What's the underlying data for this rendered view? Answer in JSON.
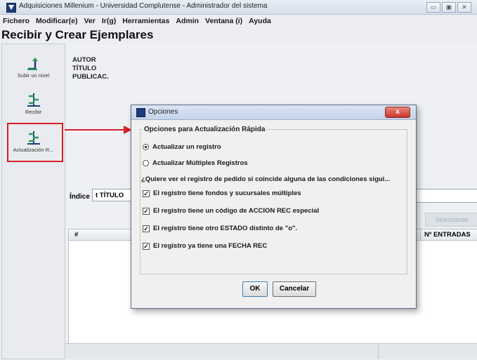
{
  "window": {
    "title": "Adquisiciones Millenium - Universidad Complutense - Administrador del sistema",
    "controls": [
      "▭",
      "▣",
      "✕"
    ]
  },
  "menu": [
    "Fichero",
    "Modificar(e)",
    "Ver",
    "Ir(g)",
    "Herramientas",
    "Admin",
    "Ventana (i)",
    "Ayuda"
  ],
  "page_title": "Recibir y Crear Ejemplares",
  "toolbar": {
    "subir_label": "Subir un nivel",
    "recibir_label": "Recibir",
    "actualizacion_label": "Actualización R..."
  },
  "record_meta": {
    "autor": "AUTOR",
    "titulo": "TÍTULO",
    "publicac": "PUBLICAC."
  },
  "search": {
    "indice_label": "Índice",
    "indice_value": "t TÍTULO",
    "seleccionar_label": "Seleccionar"
  },
  "table": {
    "col_hash": "#",
    "col_entradas": "Nº ENTRADAS"
  },
  "dialog": {
    "title": "Opciones",
    "close": "x",
    "group_title": "Opciones para Actualización Rápida",
    "radio_single": "Actualizar un registro",
    "radio_multi": "Actualizar Múltiples Registros",
    "question": "¿Quiere ver el registro de pedido si coincide alguna de las condiciones sigui...",
    "checks": [
      "El registro tiene fondos y sucursales múltiples",
      "El registro tiene un código de ACCION REC especial",
      "El registro tiene otro ESTADO distinto de \"o\".",
      "El registro ya tiene una FECHA REC"
    ],
    "ok": "OK",
    "cancel": "Cancelar"
  },
  "colors": {
    "highlight": "#d61f26",
    "accent": "#1c3d78"
  }
}
